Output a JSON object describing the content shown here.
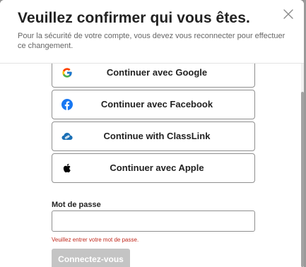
{
  "dialog": {
    "title": "Veuillez confirmer qui vous êtes.",
    "subtitle": "Pour la sécurité de votre compte, vous devez vous reconnecter pour effectuer ce changement.",
    "close_icon": "close-icon"
  },
  "providers": [
    {
      "label": "Continuer avec Google",
      "icon": "google-icon"
    },
    {
      "label": "Continuer avec Facebook",
      "icon": "facebook-icon",
      "color": "#1877f2"
    },
    {
      "label": "Continue with ClassLink",
      "icon": "classlink-icon",
      "color": "#1a6fb5"
    },
    {
      "label": "Continuer avec Apple",
      "icon": "apple-icon",
      "color": "#000000"
    }
  ],
  "password": {
    "label": "Mot de passe",
    "value": "",
    "placeholder": "",
    "error": "Veuillez entrer votre mot de passe."
  },
  "submit": {
    "label": "Connectez-vous",
    "disabled": true
  },
  "colors": {
    "error": "#c0281c",
    "button_disabled": "#c4c4c4",
    "border": "#8f8f8f"
  }
}
